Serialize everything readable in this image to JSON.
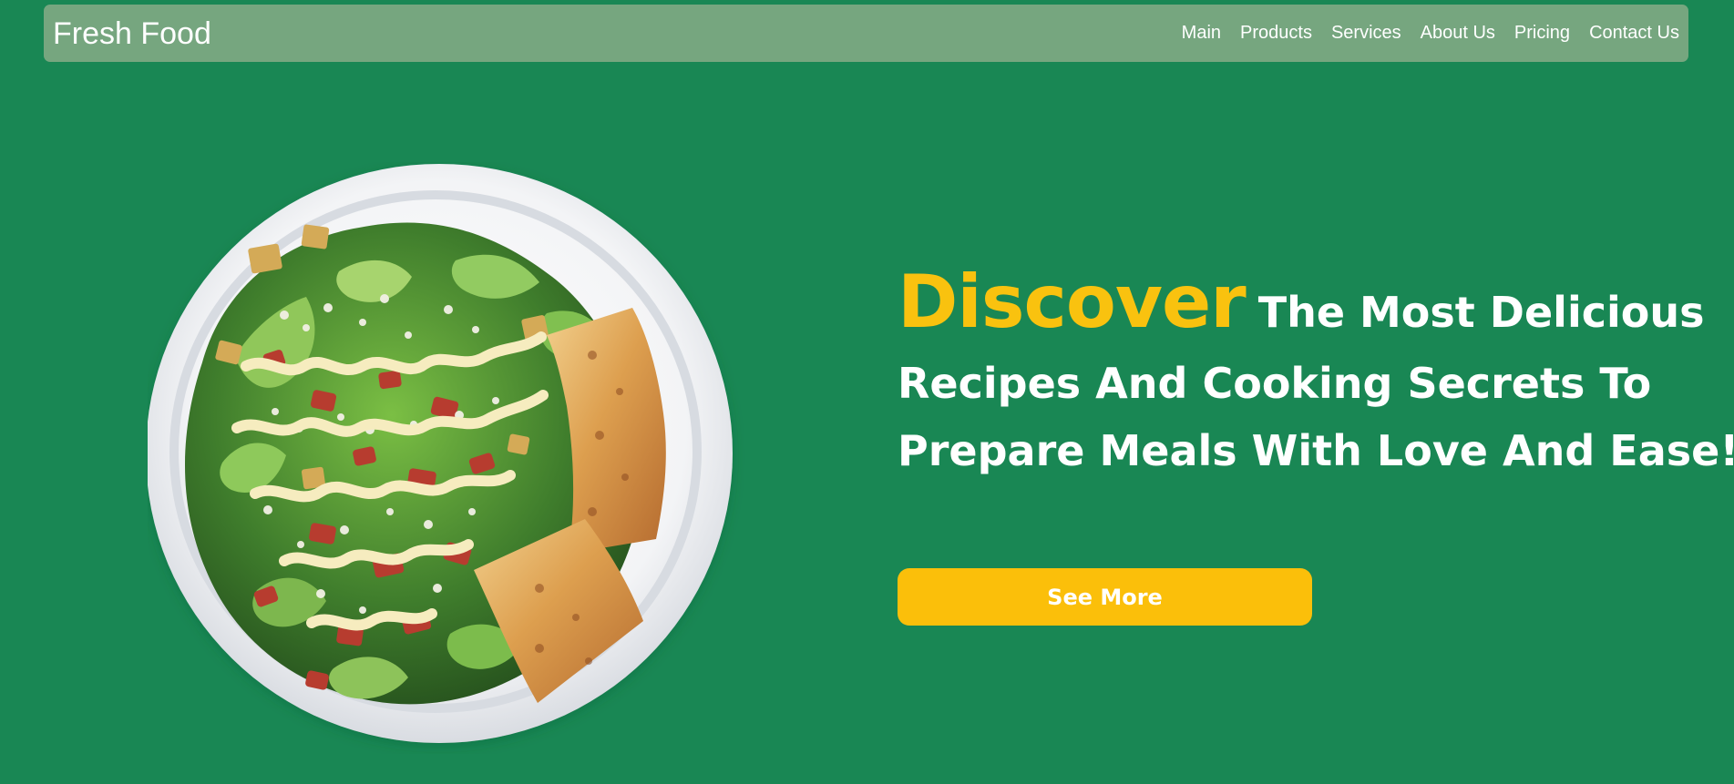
{
  "brand": {
    "name": "Fresh Food"
  },
  "nav": {
    "items": [
      {
        "label": "Main"
      },
      {
        "label": "Products"
      },
      {
        "label": "Services"
      },
      {
        "label": "About Us"
      },
      {
        "label": "Pricing"
      },
      {
        "label": "Contact Us"
      }
    ]
  },
  "hero": {
    "highlight": "Discover",
    "line1_rest": "The Most Delicious",
    "line2": "Recipes And Cooking Secrets To",
    "line3": "Prepare Meals With Love And Ease!",
    "button_label": "See More"
  },
  "image": {
    "name": "salad-plate-image"
  },
  "colors": {
    "background": "#198754",
    "navbar": "#76a67f",
    "accent": "#fbbf0a",
    "text": "#ffffff"
  }
}
